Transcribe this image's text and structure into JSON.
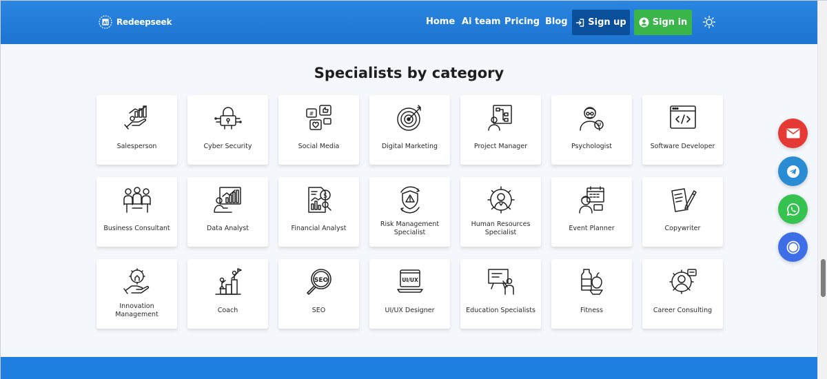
{
  "header": {
    "logo_text": "Redeepseek",
    "nav": [
      "Home",
      "Ai team",
      "Pricing",
      "Blog"
    ],
    "signup_label": "Sign up",
    "signin_label": "Sign in"
  },
  "main": {
    "title": "Specialists by category",
    "categories": [
      {
        "label": "Salesperson",
        "icon": "sales-hand-chart-icon"
      },
      {
        "label": "Cyber Security",
        "icon": "padlock-circuit-icon"
      },
      {
        "label": "Social Media",
        "icon": "social-media-icon"
      },
      {
        "label": "Digital Marketing",
        "icon": "target-dart-icon"
      },
      {
        "label": "Project Manager",
        "icon": "project-flowchart-icon"
      },
      {
        "label": "Psychologist",
        "icon": "psychologist-icon"
      },
      {
        "label": "Software Developer",
        "icon": "code-window-icon"
      },
      {
        "label": "Business Consultant",
        "icon": "meeting-icon"
      },
      {
        "label": "Data Analyst",
        "icon": "data-chart-icon"
      },
      {
        "label": "Financial Analyst",
        "icon": "financial-report-icon"
      },
      {
        "label": "Risk Management Specialist",
        "icon": "risk-shield-icon"
      },
      {
        "label": "Human Resources Specialist",
        "icon": "hr-gear-icon"
      },
      {
        "label": "Event Planner",
        "icon": "event-calendar-icon"
      },
      {
        "label": "Copywriter",
        "icon": "pen-paper-icon"
      },
      {
        "label": "Innovation Management",
        "icon": "bulb-hand-icon"
      },
      {
        "label": "Coach",
        "icon": "coach-flag-icon"
      },
      {
        "label": "SEO",
        "icon": "seo-magnifier-icon"
      },
      {
        "label": "UI/UX Designer",
        "icon": "uiux-laptop-icon"
      },
      {
        "label": "Education Specialists",
        "icon": "teacher-board-icon"
      },
      {
        "label": "Fitness",
        "icon": "fitness-food-icon"
      },
      {
        "label": "Career Consulting",
        "icon": "career-gear-icon"
      }
    ]
  },
  "floating": [
    {
      "name": "email",
      "color": "#e53935"
    },
    {
      "name": "telegram",
      "color": "#2a8dd4"
    },
    {
      "name": "whatsapp",
      "color": "#36c24f"
    },
    {
      "name": "chat",
      "color": "#3d6ee8"
    }
  ],
  "colors": {
    "header": "#1d74d1",
    "signup": "#0a4f9a",
    "signin": "#39b54a",
    "page_bg": "#f4f7fb"
  }
}
